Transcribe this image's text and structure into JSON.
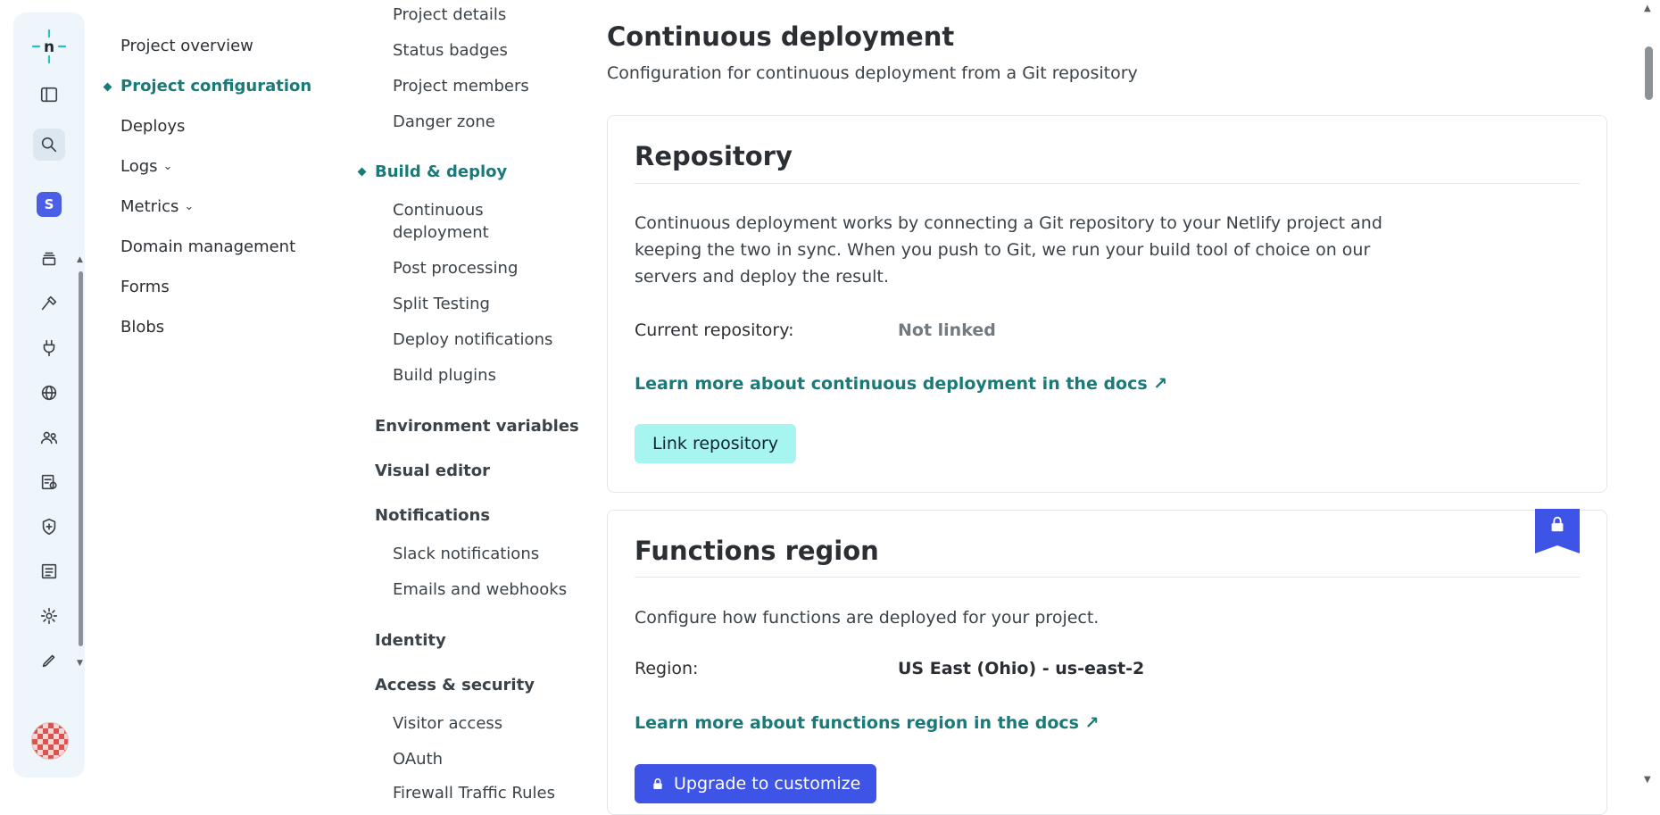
{
  "rail": {
    "team_initial": "S",
    "icons": [
      "sidebar-toggle-icon",
      "search-icon",
      "team-icon",
      "layers-icon",
      "hammer-icon",
      "plug-icon",
      "globe-icon",
      "users-icon",
      "billing-icon",
      "shield-icon",
      "docs-icon",
      "gear-icon",
      "pen-icon"
    ]
  },
  "nav": {
    "items": [
      {
        "label": "Project overview"
      },
      {
        "label": "Project configuration"
      },
      {
        "label": "Deploys"
      },
      {
        "label": "Logs"
      },
      {
        "label": "Metrics"
      },
      {
        "label": "Domain management"
      },
      {
        "label": "Forms"
      },
      {
        "label": "Blobs"
      }
    ]
  },
  "subnav": {
    "general_items": [
      "Project details",
      "Status badges",
      "Project members",
      "Danger zone"
    ],
    "build_deploy": "Build & deploy",
    "build_items": [
      "Continuous",
      "deployment",
      "Post processing",
      "Split Testing",
      "Deploy notifications",
      "Build plugins"
    ],
    "env_vars": "Environment variables",
    "visual_editor": "Visual editor",
    "notifications": "Notifications",
    "notification_items": [
      "Slack notifications",
      "Emails and webhooks"
    ],
    "identity": "Identity",
    "access_security": "Access & security",
    "access_items": [
      "Visitor access",
      "OAuth",
      "Firewall Traffic Rules"
    ]
  },
  "main": {
    "title": "Continuous deployment",
    "subtitle": "Configuration for continuous deployment from a Git repository",
    "repository": {
      "heading": "Repository",
      "description": "Continuous deployment works by connecting a Git repository to your Netlify project and keeping the two in sync. When you push to Git, we run your build tool of choice on our servers and deploy the result.",
      "current_label": "Current repository:",
      "current_value": "Not linked",
      "docs_link": "Learn more about continuous deployment in the docs ↗",
      "button": "Link repository"
    },
    "functions": {
      "heading": "Functions region",
      "description": "Configure how functions are deployed for your project.",
      "region_label": "Region:",
      "region_value": "US East (Ohio) - us-east-2",
      "docs_link": "Learn more about functions region in the docs ↗",
      "button": "Upgrade to customize"
    }
  },
  "colors": {
    "accent": "#1a7a7a",
    "link_button": "#a6f5f0",
    "upgrade": "#3d54e6",
    "muted_value": "#737a80"
  }
}
